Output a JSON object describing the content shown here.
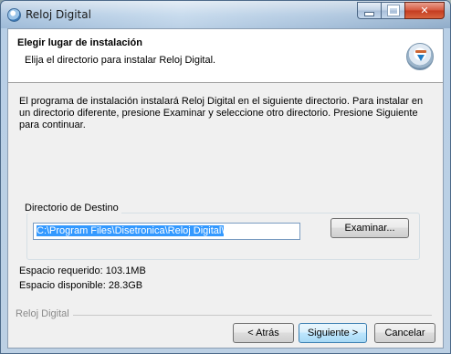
{
  "window": {
    "title": "Reloj Digital"
  },
  "header": {
    "title": "Elegir lugar de instalación",
    "subtitle": "Elija el directorio para instalar Reloj Digital."
  },
  "body": {
    "description": "El programa de instalación instalará Reloj Digital en el siguiente directorio. Para instalar en un directorio diferente, presione Examinar y seleccione otro directorio. Presione Siguiente para continuar."
  },
  "destination": {
    "group_label": "Directorio de Destino",
    "path": "C:\\Program Files\\Disetronica\\Reloj Digital\\",
    "browse_label": "Examinar..."
  },
  "space": {
    "required": "Espacio requerido: 103.1MB",
    "available": "Espacio disponible: 28.3GB"
  },
  "footer": {
    "brand": "Reloj Digital",
    "back_label": "< Atrás",
    "next_label": "Siguiente >",
    "cancel_label": "Cancelar"
  },
  "icons": {
    "app": "app-clock-icon",
    "header": "installer-disk-icon",
    "minimize": "minimize-icon",
    "maximize": "maximize-icon",
    "close": "close-icon"
  }
}
